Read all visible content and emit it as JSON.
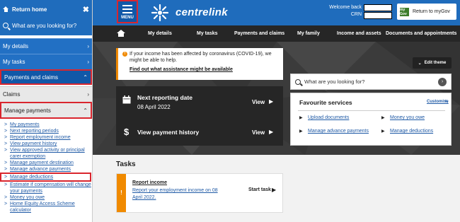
{
  "sidebar": {
    "return_home": "Return home",
    "close": "✖",
    "search": "What are you looking for?",
    "items": [
      {
        "label": "My details",
        "arrow": "›"
      },
      {
        "label": "My tasks",
        "arrow": "›"
      },
      {
        "label": "Payments and claims",
        "arrow": "⌃"
      }
    ],
    "subitems": [
      {
        "label": "Claims",
        "arrow": "›"
      },
      {
        "label": "Manage payments",
        "arrow": "⌃"
      }
    ],
    "links": [
      "My payments",
      "Next reporting periods",
      "Report employment income",
      "View payment history",
      "View approved activity or principal carer exemption",
      "Manage payment destination",
      "Manage advance payments",
      "Manage deductions",
      "Estimate if compensation will change your payments",
      "Money you owe",
      "Home Equity Access Scheme calculator"
    ]
  },
  "header": {
    "menu_label": "MENU",
    "brand": "centrelink",
    "welcome": "Welcome back",
    "crn": "CRN",
    "mygov_badge": "my Gov",
    "mygov_label": "Return to myGov"
  },
  "nav": [
    "My details",
    "My tasks",
    "Payments and claims",
    "My family",
    "Income and assets",
    "Documents and appointments"
  ],
  "notice": {
    "text": "If your income has been affected by coronavirus (COVID-19), we might be able to help.",
    "link": "Find out what assistance might be available"
  },
  "edit_theme": "Edit theme",
  "cards": [
    {
      "title": "Next reporting date",
      "sub": "08 April 2022",
      "action": "View"
    },
    {
      "title": "View payment history",
      "action": "View"
    }
  ],
  "search": {
    "placeholder": "What are you looking for?"
  },
  "favourites": {
    "title": "Favourite services",
    "customise": "Customise",
    "items": [
      "Upload documents",
      "Money you owe",
      "Manage advance payments",
      "Manage deductions"
    ]
  },
  "tasks": {
    "title": "Tasks",
    "item_title": "Report income",
    "item_desc": "Report your employment income on 08 April 2022.",
    "action": "Start task"
  },
  "colors": {
    "brand_blue": "#1f6cbc",
    "highlight_red": "#d9262e",
    "orange": "#f08a00",
    "dark": "#262626"
  }
}
